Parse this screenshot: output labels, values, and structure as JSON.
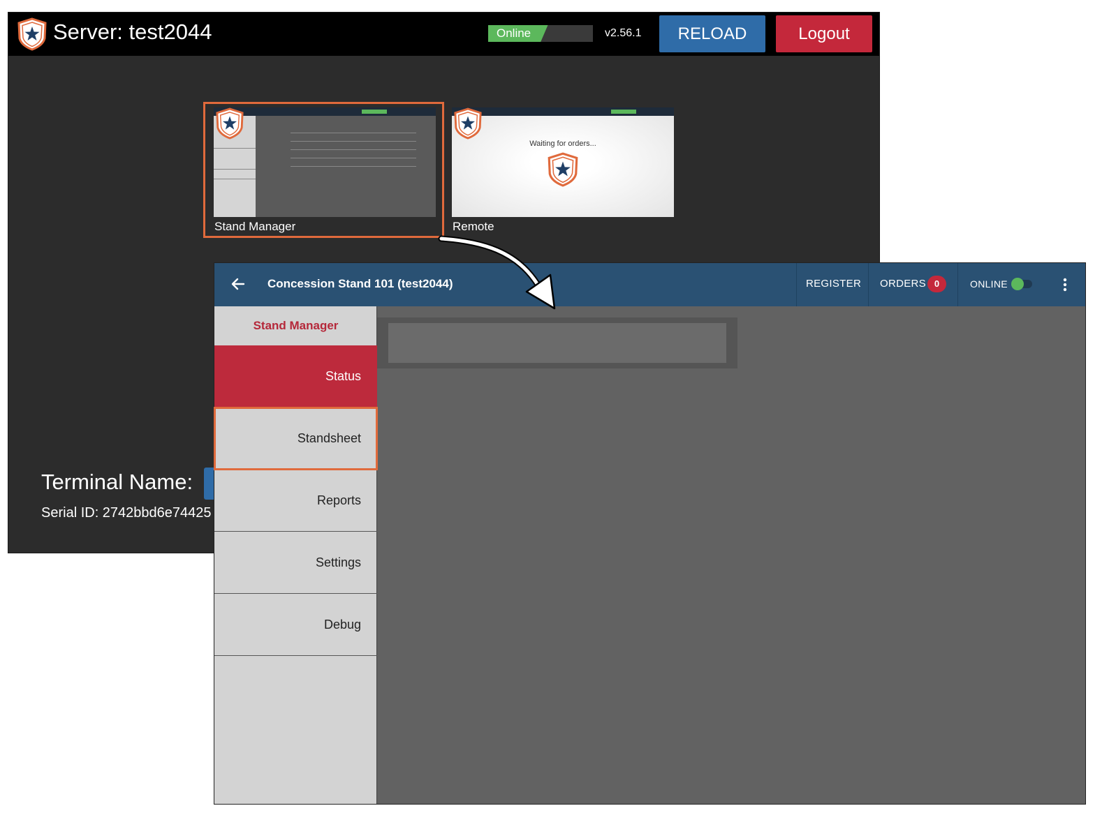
{
  "launcher": {
    "server_title": "Server: test2044",
    "status_label": "Online",
    "status_fill_fraction": 0.57,
    "version": "v2.56.1",
    "reload_label": "RELOAD",
    "logout_label": "Logout",
    "apps": [
      {
        "label": "Stand Manager",
        "selected": true
      },
      {
        "label": "Remote",
        "selected": false
      }
    ],
    "remote_waiting_text": "Waiting for orders...",
    "terminal_label": "Terminal Name:",
    "serial_label": "Serial ID: 2742bbd6e74425"
  },
  "app": {
    "title": "Concession Stand 101 (test2044)",
    "header": {
      "register_label": "REGISTER",
      "orders_label": "ORDERS",
      "orders_count": "0",
      "online_label": "ONLINE",
      "online_enabled": true
    },
    "sidebar": {
      "heading": "Stand Manager",
      "items": [
        {
          "label": "Status",
          "active": true
        },
        {
          "label": "Standsheet",
          "active": false,
          "highlighted": true
        },
        {
          "label": "Reports",
          "active": false
        },
        {
          "label": "Settings",
          "active": false
        },
        {
          "label": "Debug",
          "active": false
        }
      ]
    }
  },
  "colors": {
    "brand_blue": "#2a5173",
    "accent_red": "#bd2a3c",
    "highlight_orange": "#e06a3c",
    "online_green": "#5cb85c"
  },
  "icons": [
    "shield-star-logo-icon",
    "back-arrow-icon",
    "kebab-menu-icon",
    "toggle-icon",
    "curved-arrow-icon"
  ]
}
